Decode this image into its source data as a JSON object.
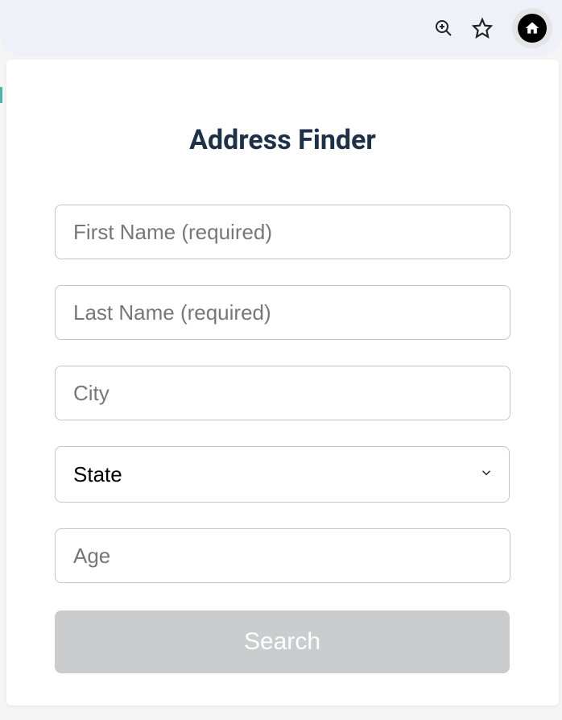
{
  "browser": {
    "icons": {
      "zoom": "zoom-in-icon",
      "star": "star-icon",
      "home": "home-icon"
    }
  },
  "page": {
    "title": "Address Finder"
  },
  "form": {
    "first_name": {
      "placeholder": "First Name (required)",
      "value": ""
    },
    "last_name": {
      "placeholder": "Last Name (required)",
      "value": ""
    },
    "city": {
      "placeholder": "City",
      "value": ""
    },
    "state": {
      "selected": "State"
    },
    "age": {
      "placeholder": "Age",
      "value": ""
    },
    "submit_label": "Search"
  }
}
